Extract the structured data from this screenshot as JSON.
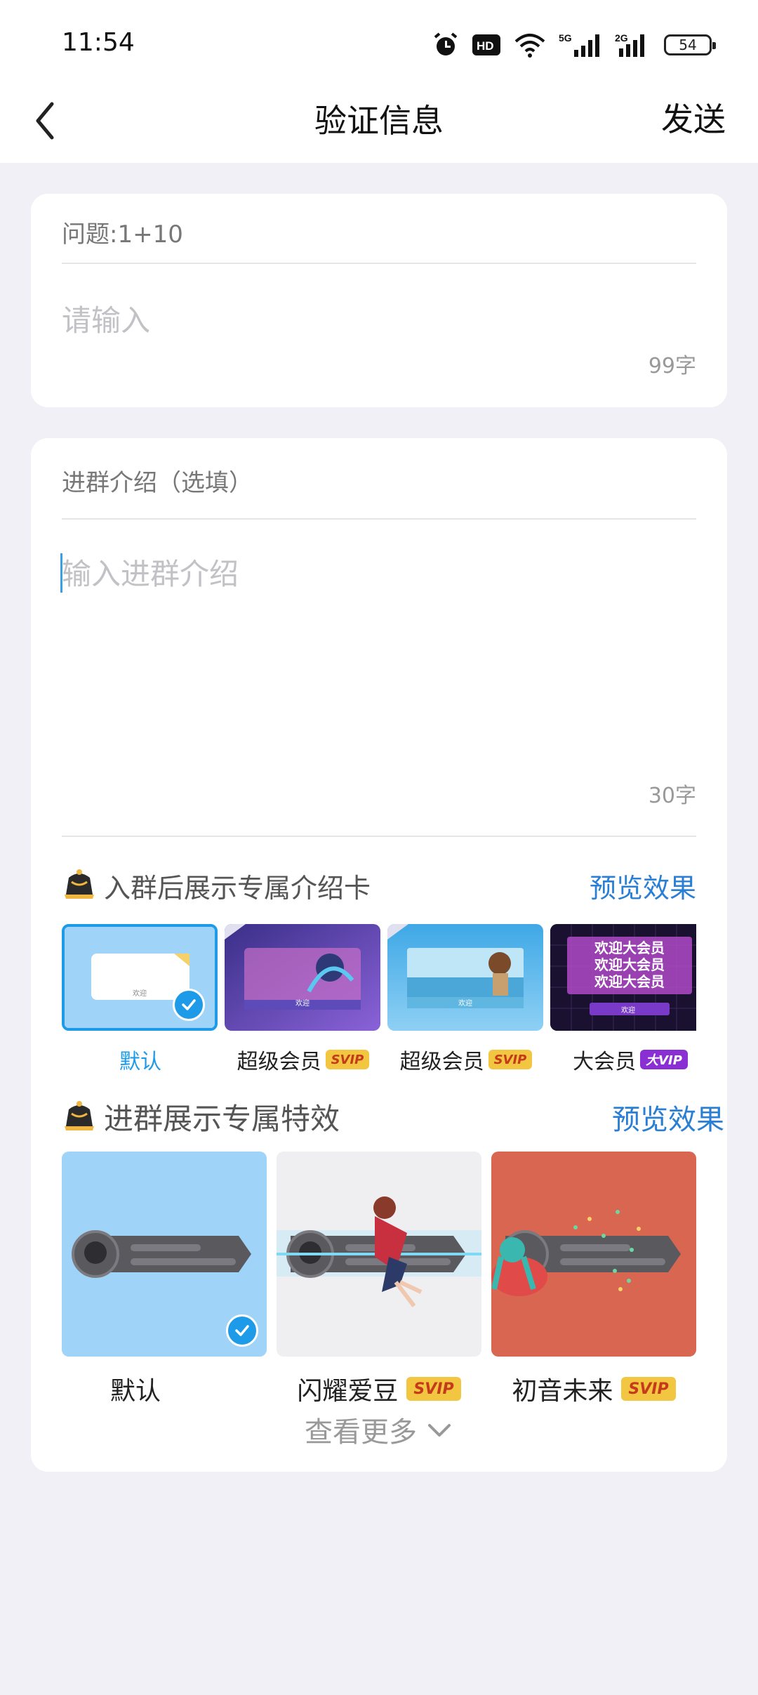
{
  "status_bar": {
    "time": "11:54",
    "battery": "54",
    "icons": [
      "alarm-icon",
      "hd-icon",
      "wifi-icon",
      "5g-signal-icon",
      "2g-signal-icon",
      "battery-icon"
    ]
  },
  "nav": {
    "title": "验证信息",
    "send_label": "发送",
    "back_icon": "chevron-left-icon"
  },
  "question_card": {
    "question": "问题:1+10",
    "answer_placeholder": "请输入",
    "counter": "99字"
  },
  "intro_card": {
    "label": "进群介绍（选填）",
    "placeholder": "输入进群介绍",
    "counter": "30字",
    "intro_section": {
      "title": "入群后展示专属介绍卡",
      "preview_label": "预览效果",
      "items": [
        {
          "label": "默认",
          "badge": "",
          "selected": true,
          "card_text": "欢迎"
        },
        {
          "label": "超级会员",
          "badge": "SVIP",
          "selected": false,
          "card_text": "欢迎"
        },
        {
          "label": "超级会员",
          "badge": "SVIP",
          "selected": false,
          "card_text": "欢迎"
        },
        {
          "label": "大会员",
          "badge": "大VIP",
          "selected": false,
          "card_text": "欢迎",
          "banner_text": "欢迎大会员"
        }
      ]
    },
    "effect_section": {
      "title": "进群展示专属特效",
      "preview_label": "预览效果",
      "items": [
        {
          "label": "默认",
          "badge": "",
          "selected": true,
          "bg": "#9fd3f8"
        },
        {
          "label": "闪耀爱豆",
          "badge": "SVIP",
          "selected": false,
          "bg": "#efeff1"
        },
        {
          "label": "初音未来",
          "badge": "SVIP",
          "selected": false,
          "bg": "#d86650"
        }
      ],
      "more_label": "查看更多"
    }
  },
  "colors": {
    "accent": "#1e9be8",
    "link": "#2a7fd4",
    "page_bg": "#f0f0f6"
  }
}
